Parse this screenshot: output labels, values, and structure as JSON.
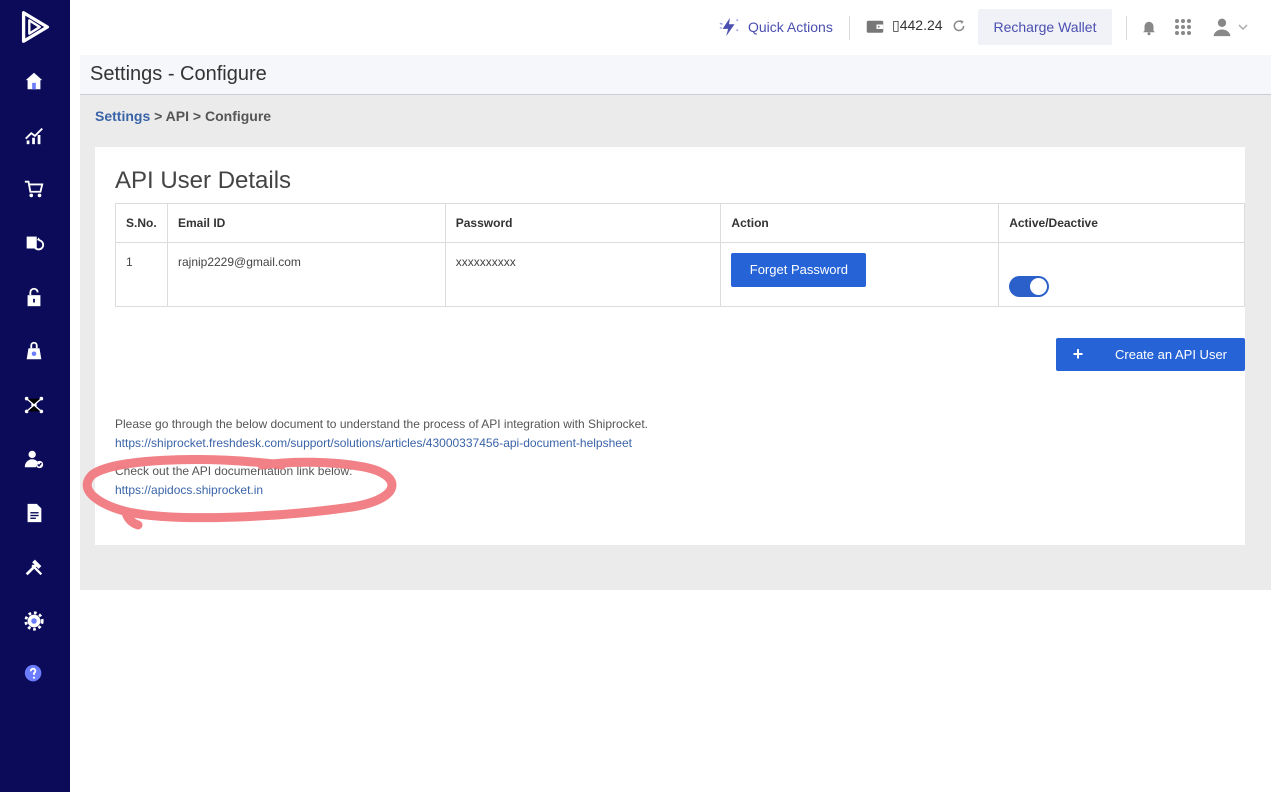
{
  "topbar": {
    "quick_actions_label": "Quick Actions",
    "wallet_amount": "▯442.24",
    "recharge_label": "Recharge Wallet"
  },
  "header": {
    "title": "Settings - Configure"
  },
  "breadcrumb": {
    "settings": "Settings",
    "sep1": " > ",
    "api": "API",
    "sep2": " > ",
    "configure": "Configure"
  },
  "card": {
    "title": "API User Details",
    "table": {
      "headers": {
        "sno": "S.No.",
        "email": "Email ID",
        "password": "Password",
        "action": "Action",
        "active": "Active/Deactive"
      },
      "row": {
        "sno": "1",
        "email": "rajnip2229@gmail.com",
        "password": "xxxxxxxxxx",
        "action_label": "Forget Password",
        "active": true
      }
    },
    "create_button_label": "Create an API User",
    "info_text": "Please go through the below document to understand the process of API integration with Shiprocket.",
    "info_link": "https://shiprocket.freshdesk.com/support/solutions/articles/43000337456-api-document-helpsheet",
    "docs_text": "Check out the API documentation link below:",
    "docs_link": "https://apidocs.shiprocket.in"
  },
  "colors": {
    "sidebar": "#0b0b5a",
    "accent": "#2563d6",
    "link": "#3a64a8",
    "annotation": "#f07a80"
  },
  "sidebar_icons": [
    "home-icon",
    "analytics-icon",
    "cart-icon",
    "returns-icon",
    "lock-icon",
    "bag-icon",
    "network-icon",
    "user-check-icon",
    "document-icon",
    "tools-icon",
    "gear-icon",
    "help-icon"
  ]
}
